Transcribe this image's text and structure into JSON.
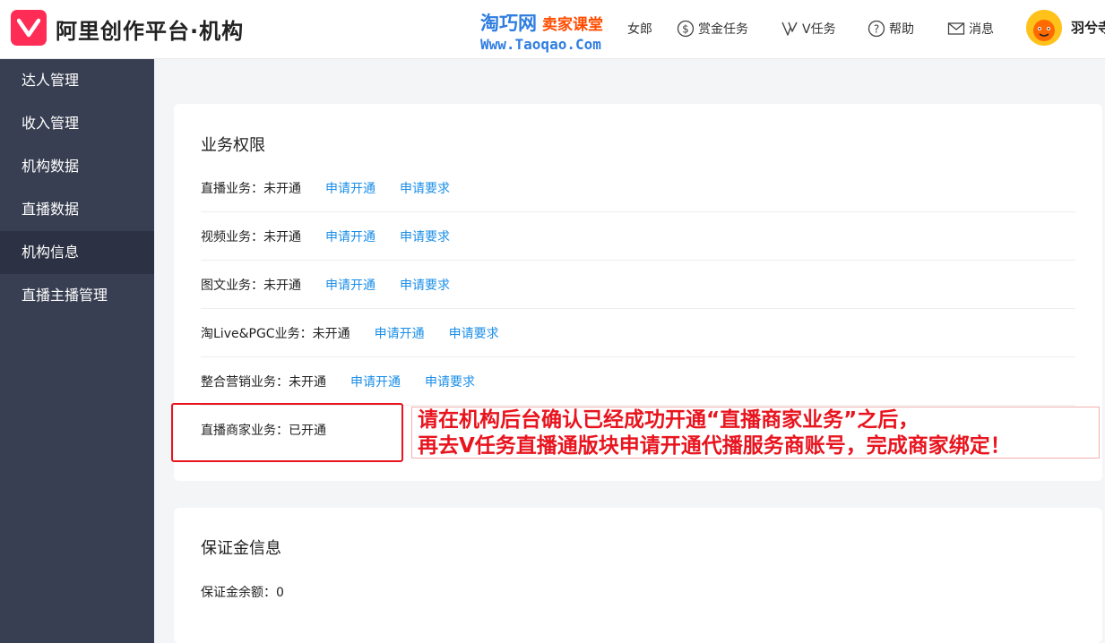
{
  "header": {
    "brand": "阿里创作平台·机构",
    "watermark_cn": "淘巧网",
    "watermark_red": "卖家课堂",
    "watermark_url": "Www.Taoqao.Com",
    "partial_nav": "女郎",
    "nav": [
      {
        "label": "赏金任务",
        "icon": "dollar-circle-icon"
      },
      {
        "label": "V任务",
        "icon": "v-task-icon"
      },
      {
        "label": "帮助",
        "icon": "help-icon"
      },
      {
        "label": "消息",
        "icon": "mail-icon"
      }
    ],
    "username": "羽兮寺"
  },
  "sidebar": {
    "items": [
      {
        "label": "达人管理"
      },
      {
        "label": "收入管理"
      },
      {
        "label": "机构数据"
      },
      {
        "label": "直播数据"
      },
      {
        "label": "机构信息",
        "active": true
      },
      {
        "label": "直播主播管理"
      }
    ]
  },
  "business": {
    "title": "业务权限",
    "rows": [
      {
        "label": "直播业务：未开通",
        "apply": "申请开通",
        "req": "申请要求"
      },
      {
        "label": "视频业务：未开通",
        "apply": "申请开通",
        "req": "申请要求"
      },
      {
        "label": "图文业务：未开通",
        "apply": "申请开通",
        "req": "申请要求"
      },
      {
        "label": "淘Live&PGC业务：未开通",
        "apply": "申请开通",
        "req": "申请要求"
      },
      {
        "label": "整合营销业务：未开通",
        "apply": "申请开通",
        "req": "申请要求"
      },
      {
        "label": "直播商家业务：已开通"
      }
    ]
  },
  "annotation": {
    "line1": "请在机构后台确认已经成功开通“直播商家业务”之后，",
    "line2": "再去V任务直播通版块申请开通代播服务商账号，完成商家绑定！"
  },
  "deposit": {
    "title": "保证金信息",
    "balance": "保证金余额：0"
  },
  "colors": {
    "brand": "#ff2d55",
    "sidebar_bg": "#383f52",
    "link": "#1a8ee8",
    "annotation_red": "#e8141e"
  }
}
